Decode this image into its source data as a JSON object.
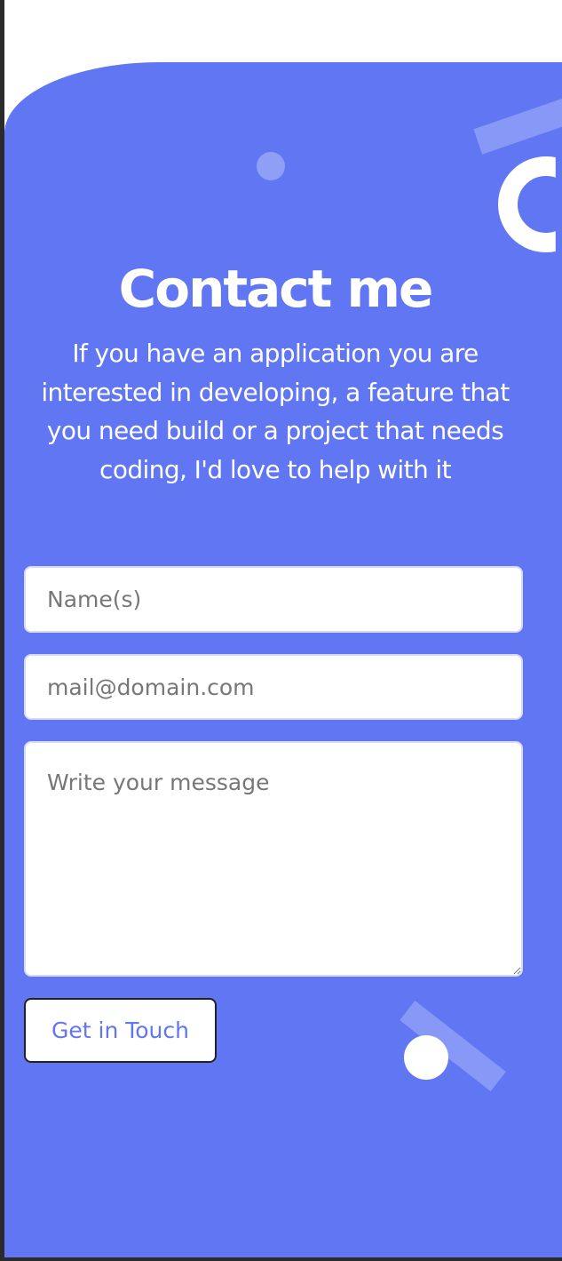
{
  "contact": {
    "title": "Contact me",
    "description": "If you have an application you are interested in developing, a feature that you need build or a project that needs coding, I'd love to help with it"
  },
  "form": {
    "name_placeholder": "Name(s)",
    "email_placeholder": "mail@domain.com",
    "message_placeholder": "Write your message",
    "submit_label": "Get in Touch"
  },
  "colors": {
    "accent": "#6076f3",
    "background": "#ffffff",
    "text_on_accent": "#ffffff"
  }
}
